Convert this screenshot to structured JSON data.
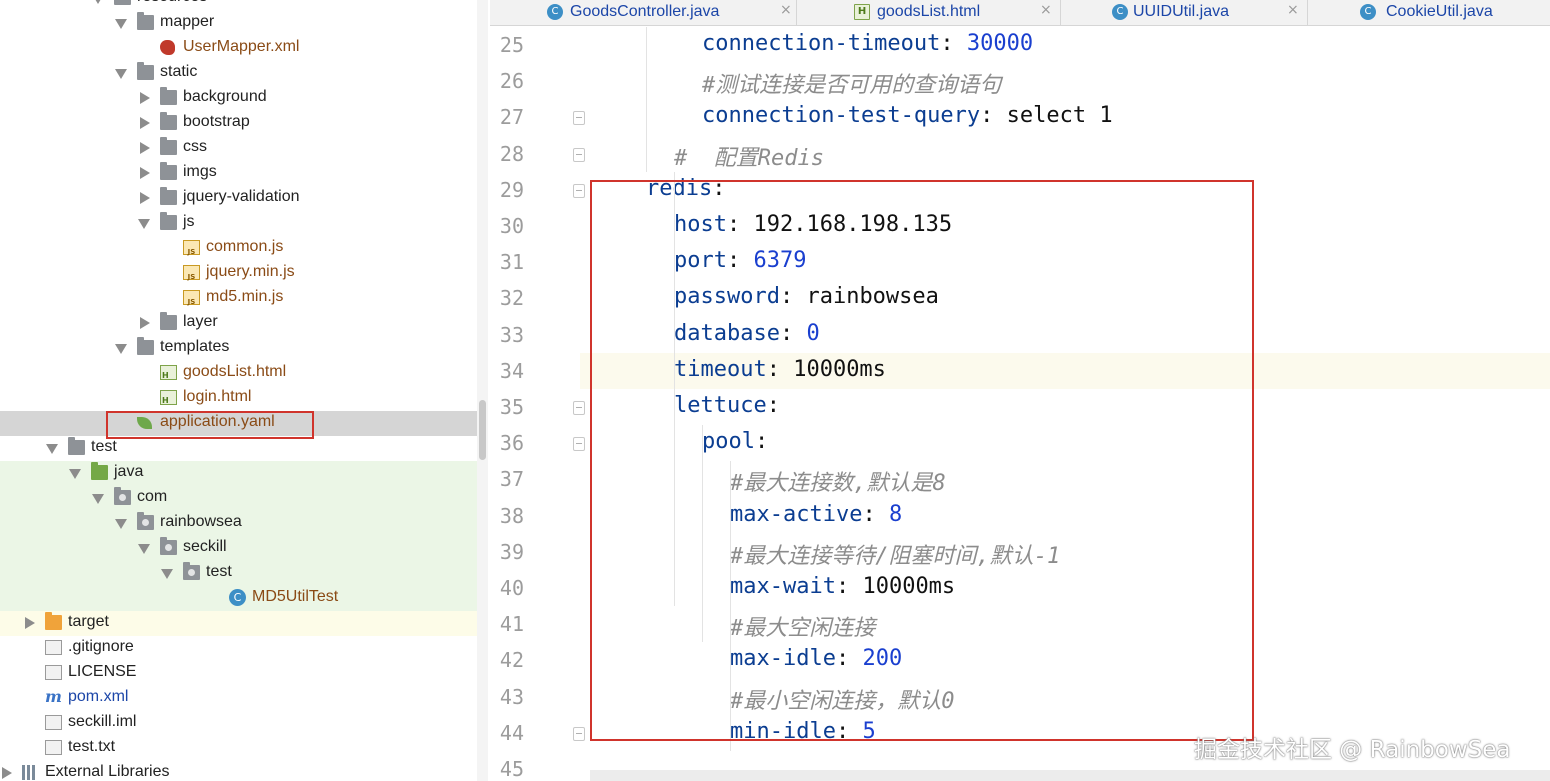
{
  "project_tree": {
    "items": [
      {
        "label": "resources",
        "icon": "folder-icon",
        "expanded": true,
        "indent": 4
      },
      {
        "label": "mapper",
        "icon": "folder-icon",
        "expanded": true,
        "indent": 5
      },
      {
        "label": "UserMapper.xml",
        "icon": "mybatis-xml-icon",
        "indent": 6
      },
      {
        "label": "static",
        "icon": "folder-icon",
        "expanded": true,
        "indent": 5
      },
      {
        "label": "background",
        "icon": "folder-icon",
        "expanded": false,
        "indent": 6
      },
      {
        "label": "bootstrap",
        "icon": "folder-icon",
        "expanded": false,
        "indent": 6
      },
      {
        "label": "css",
        "icon": "folder-icon",
        "expanded": false,
        "indent": 6
      },
      {
        "label": "imgs",
        "icon": "folder-icon",
        "expanded": false,
        "indent": 6
      },
      {
        "label": "jquery-validation",
        "icon": "folder-icon",
        "expanded": false,
        "indent": 6
      },
      {
        "label": "js",
        "icon": "folder-icon",
        "expanded": true,
        "indent": 6
      },
      {
        "label": "common.js",
        "icon": "js-file-icon",
        "indent": 7
      },
      {
        "label": "jquery.min.js",
        "icon": "js-file-icon",
        "indent": 7
      },
      {
        "label": "md5.min.js",
        "icon": "js-file-icon",
        "indent": 7
      },
      {
        "label": "layer",
        "icon": "folder-icon",
        "expanded": false,
        "indent": 6
      },
      {
        "label": "templates",
        "icon": "folder-icon",
        "expanded": true,
        "indent": 5
      },
      {
        "label": "goodsList.html",
        "icon": "html-file-icon",
        "indent": 6
      },
      {
        "label": "login.html",
        "icon": "html-file-icon",
        "indent": 6
      },
      {
        "label": "application.yaml",
        "icon": "spring-yaml-icon",
        "indent": 5,
        "selected": true
      },
      {
        "label": "test",
        "icon": "folder-icon",
        "expanded": true,
        "indent": 2
      },
      {
        "label": "java",
        "icon": "test-source-folder-icon",
        "expanded": true,
        "indent": 3
      },
      {
        "label": "com",
        "icon": "package-icon",
        "expanded": true,
        "indent": 4
      },
      {
        "label": "rainbowsea",
        "icon": "package-icon",
        "expanded": true,
        "indent": 5
      },
      {
        "label": "seckill",
        "icon": "package-icon",
        "expanded": true,
        "indent": 6
      },
      {
        "label": "test",
        "icon": "package-icon",
        "expanded": true,
        "indent": 7
      },
      {
        "label": "MD5UtilTest",
        "icon": "class-icon",
        "indent": 9
      },
      {
        "label": "target",
        "icon": "excluded-folder-icon",
        "expanded": false,
        "indent": 1
      },
      {
        "label": ".gitignore",
        "icon": "ignore-file-icon",
        "indent": 1
      },
      {
        "label": "LICENSE",
        "icon": "text-file-icon",
        "indent": 1
      },
      {
        "label": "pom.xml",
        "icon": "maven-icon",
        "indent": 1
      },
      {
        "label": "seckill.iml",
        "icon": "iml-file-icon",
        "indent": 1
      },
      {
        "label": "test.txt",
        "icon": "text-file-icon",
        "indent": 1
      },
      {
        "label": "External Libraries",
        "icon": "libraries-icon",
        "expanded": false,
        "indent": 0
      }
    ]
  },
  "tabs": [
    {
      "label": "GoodsController.java",
      "icon": "class-icon"
    },
    {
      "label": "goodsList.html",
      "icon": "html-file-icon"
    },
    {
      "label": "UUIDUtil.java",
      "icon": "class-icon"
    },
    {
      "label": "CookieUtil.java",
      "icon": "class-icon"
    }
  ],
  "close_glyph": "×",
  "editor": {
    "current_line": 34,
    "lines": [
      {
        "n": "25",
        "indent": 3,
        "parts": [
          {
            "t": "connection-timeout",
            "s": "k"
          },
          {
            "t": ": ",
            "s": "t"
          },
          {
            "t": "30000",
            "s": "v"
          }
        ]
      },
      {
        "n": "26",
        "indent": 3,
        "parts": [
          {
            "t": "#测试连接是否可用的查询语句",
            "s": "c"
          }
        ]
      },
      {
        "n": "27",
        "indent": 3,
        "parts": [
          {
            "t": "connection-test-query",
            "s": "k"
          },
          {
            "t": ": select 1",
            "s": "t"
          }
        ]
      },
      {
        "n": "28",
        "indent": 2,
        "parts": [
          {
            "t": "#  配置Redis",
            "s": "c"
          }
        ]
      },
      {
        "n": "29",
        "indent": 1,
        "parts": [
          {
            "t": "redis",
            "s": "k"
          },
          {
            "t": ":",
            "s": "t"
          }
        ]
      },
      {
        "n": "30",
        "indent": 2,
        "parts": [
          {
            "t": "host",
            "s": "k"
          },
          {
            "t": ": 192.168.198.135",
            "s": "t"
          }
        ]
      },
      {
        "n": "31",
        "indent": 2,
        "parts": [
          {
            "t": "port",
            "s": "k"
          },
          {
            "t": ": ",
            "s": "t"
          },
          {
            "t": "6379",
            "s": "v"
          }
        ]
      },
      {
        "n": "32",
        "indent": 2,
        "parts": [
          {
            "t": "password",
            "s": "k"
          },
          {
            "t": ": rainbowsea",
            "s": "t"
          }
        ]
      },
      {
        "n": "33",
        "indent": 2,
        "parts": [
          {
            "t": "database",
            "s": "k"
          },
          {
            "t": ": ",
            "s": "t"
          },
          {
            "t": "0",
            "s": "v"
          }
        ]
      },
      {
        "n": "34",
        "indent": 2,
        "parts": [
          {
            "t": "timeout",
            "s": "k"
          },
          {
            "t": ": 10000ms",
            "s": "t"
          }
        ]
      },
      {
        "n": "35",
        "indent": 2,
        "parts": [
          {
            "t": "lettuce",
            "s": "k"
          },
          {
            "t": ":",
            "s": "t"
          }
        ]
      },
      {
        "n": "36",
        "indent": 3,
        "parts": [
          {
            "t": "pool",
            "s": "k"
          },
          {
            "t": ":",
            "s": "t"
          }
        ]
      },
      {
        "n": "37",
        "indent": 4,
        "parts": [
          {
            "t": "#最大连接数,默认是8",
            "s": "c"
          }
        ]
      },
      {
        "n": "38",
        "indent": 4,
        "parts": [
          {
            "t": "max-active",
            "s": "k"
          },
          {
            "t": ": ",
            "s": "t"
          },
          {
            "t": "8",
            "s": "v"
          }
        ]
      },
      {
        "n": "39",
        "indent": 4,
        "parts": [
          {
            "t": "#最大连接等待/阻塞时间,默认-1",
            "s": "c"
          }
        ]
      },
      {
        "n": "40",
        "indent": 4,
        "parts": [
          {
            "t": "max-wait",
            "s": "k"
          },
          {
            "t": ": 10000ms",
            "s": "t"
          }
        ]
      },
      {
        "n": "41",
        "indent": 4,
        "parts": [
          {
            "t": "#最大空闲连接",
            "s": "c"
          }
        ]
      },
      {
        "n": "42",
        "indent": 4,
        "parts": [
          {
            "t": "max-idle",
            "s": "k"
          },
          {
            "t": ": ",
            "s": "t"
          },
          {
            "t": "200",
            "s": "v"
          }
        ]
      },
      {
        "n": "43",
        "indent": 4,
        "parts": [
          {
            "t": "#最小空闲连接，默认0",
            "s": "c"
          }
        ]
      },
      {
        "n": "44",
        "indent": 4,
        "parts": [
          {
            "t": "min-idle",
            "s": "k"
          },
          {
            "t": ": ",
            "s": "t"
          },
          {
            "t": "5",
            "s": "v"
          }
        ]
      },
      {
        "n": "45",
        "indent": 0,
        "parts": []
      }
    ]
  },
  "watermark": "掘金技术社区 @ RainbowSea",
  "colors": {
    "highlight_box": "#d0342c",
    "yaml_key": "#0b3d91",
    "yaml_number": "#1a3fcf",
    "comment": "#8c8c8c",
    "selected_row": "#d5d5d5",
    "test_band": "#ebf6e6"
  }
}
